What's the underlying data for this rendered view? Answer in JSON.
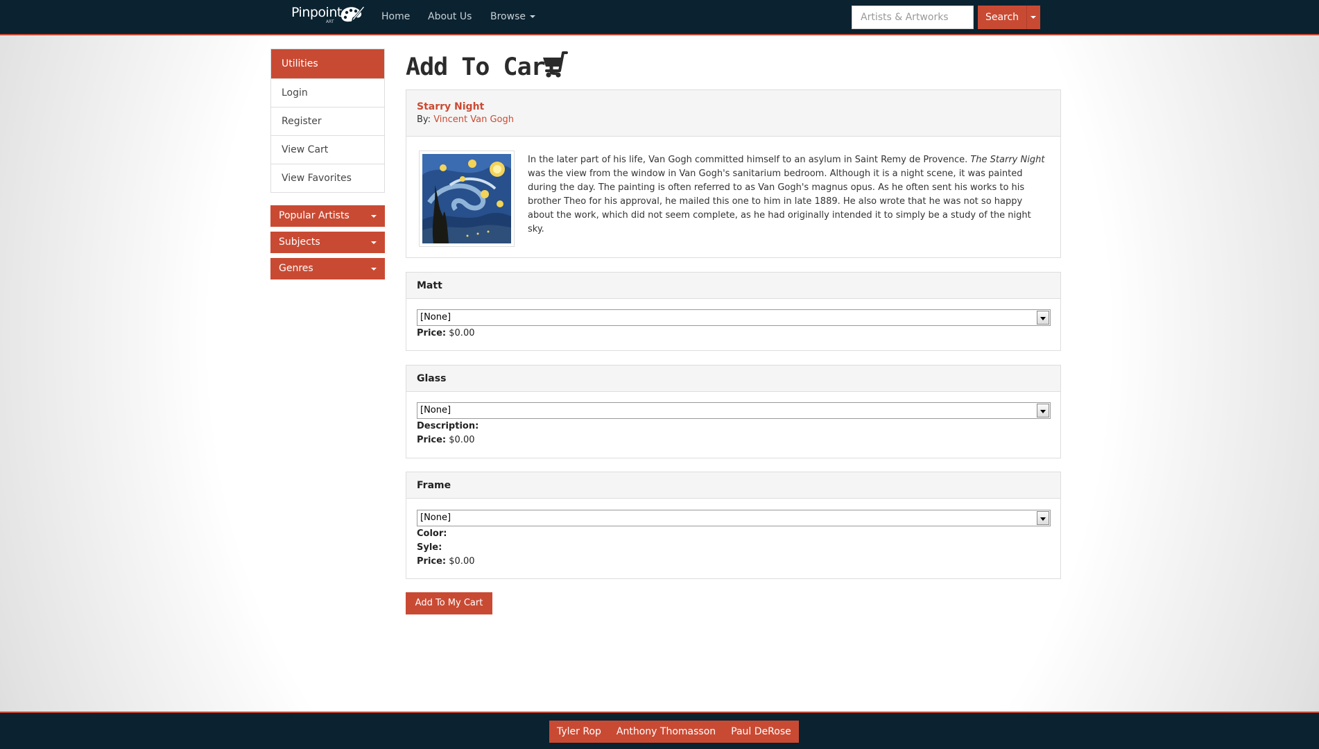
{
  "brand": {
    "name": "Pinpoint",
    "sub": "ART"
  },
  "nav": {
    "home": "Home",
    "about": "About Us",
    "browse": "Browse"
  },
  "search": {
    "placeholder": "Artists & Artworks",
    "button": "Search"
  },
  "sidebar": {
    "heading": "Utilities",
    "items": [
      {
        "label": "Login"
      },
      {
        "label": "Register"
      },
      {
        "label": "View Cart"
      },
      {
        "label": "View Favorites"
      }
    ],
    "dropdowns": [
      {
        "label": "Popular Artists"
      },
      {
        "label": "Subjects"
      },
      {
        "label": "Genres"
      }
    ]
  },
  "page": {
    "title": "Add To Cart"
  },
  "artwork": {
    "title": "Starry Night",
    "by_label": "By:",
    "artist": "Vincent Van Gogh",
    "desc_before": "In the later part of his life, Van Gogh committed himself to an asylum in Saint Remy de Provence. ",
    "desc_italic": "The Starry Night",
    "desc_after": " was the view from the window in Van Gogh's sanitarium bedroom. Although it is a night scene, it was painted during the day. The painting is often referred to as Van Gogh's magnus opus. As he often sent his works to his brother Theo for his approval, he mailed this one to him in late 1889. He also wrote that he was not so happy about the work, which did not seem complete, as he had originally intended it to simply be a study of the night sky."
  },
  "options": {
    "matt": {
      "title": "Matt",
      "selected": "[None]",
      "price_label": "Price:",
      "price": "$0.00"
    },
    "glass": {
      "title": "Glass",
      "selected": "[None]",
      "description_label": "Description:",
      "price_label": "Price:",
      "price": "$0.00"
    },
    "frame": {
      "title": "Frame",
      "selected": "[None]",
      "color_label": "Color:",
      "style_label": "Syle:",
      "price_label": "Price:",
      "price": "$0.00"
    }
  },
  "actions": {
    "add_to_cart": "Add To My Cart"
  },
  "footer": {
    "names": [
      "Tyler Rop",
      "Anthony Thomasson",
      "Paul DeRose"
    ]
  },
  "colors": {
    "accent": "#c94a33",
    "navbar": "#0b2230"
  }
}
